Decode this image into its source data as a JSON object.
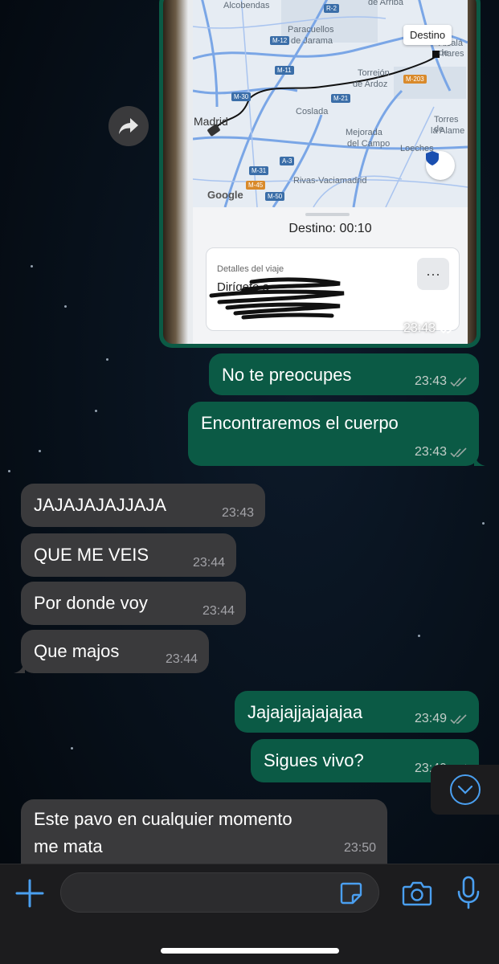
{
  "image_message": {
    "map_labels": {
      "alcobendas": "Alcobendas",
      "de_arriba": "de Arriba",
      "paracuellos": "Paracuellos",
      "de_jarama": "de Jarama",
      "destino": "Destino",
      "alcala": "Alcalá de",
      "henares": "nares",
      "torrejon": "Torrejón",
      "de_ardoz": "de Ardoz",
      "madrid": "Madrid",
      "coslada": "Coslada",
      "torres": "Torres de",
      "la_alameda": "la Alame",
      "mejorada": "Mejorada",
      "del_campo": "del Campo",
      "loeches": "Loeches",
      "rivas": "Rivas-Vaciamadrid",
      "google": "Google"
    },
    "road_badges": [
      "R-2",
      "M-12",
      "M-11",
      "M-30",
      "M-203",
      "M-21",
      "M-31",
      "M-45",
      "M-50",
      "A-3",
      "A-2"
    ],
    "eta": "Destino: 00:10",
    "trip_caption": "Detalles del viaje",
    "trip_destination": "Dirígete a",
    "more_icon": "···",
    "time": "23:43"
  },
  "messages": [
    {
      "text": "No te preocupes",
      "time": "23:43"
    },
    {
      "text": "Encontraremos el cuerpo",
      "time": "23:43"
    },
    {
      "text": "JAJAJAJAJJAJA",
      "time": "23:43"
    },
    {
      "text": "QUE ME VEIS",
      "time": "23:44"
    },
    {
      "text": "Por donde voy",
      "time": "23:44"
    },
    {
      "text": "Que majos",
      "time": "23:44"
    },
    {
      "text": "Jajajajjajajajaa",
      "time": "23:49"
    },
    {
      "text": "Sigues vivo?",
      "time": "23:49"
    },
    {
      "text": "Este pavo en cualquier momento",
      "text2": "me mata",
      "time": "23:50"
    }
  ],
  "icons": {
    "forward": "forward-icon",
    "read_receipt": "double-check-icon",
    "scroll_down": "chevron-down-icon",
    "attach": "plus-icon",
    "sticker": "sticker-icon",
    "camera": "camera-icon",
    "microphone": "microphone-icon"
  },
  "colors": {
    "outgoing_bubble": "#0b5a45",
    "incoming_bubble": "#3a3a3c",
    "accent": "#4a9ff0"
  }
}
